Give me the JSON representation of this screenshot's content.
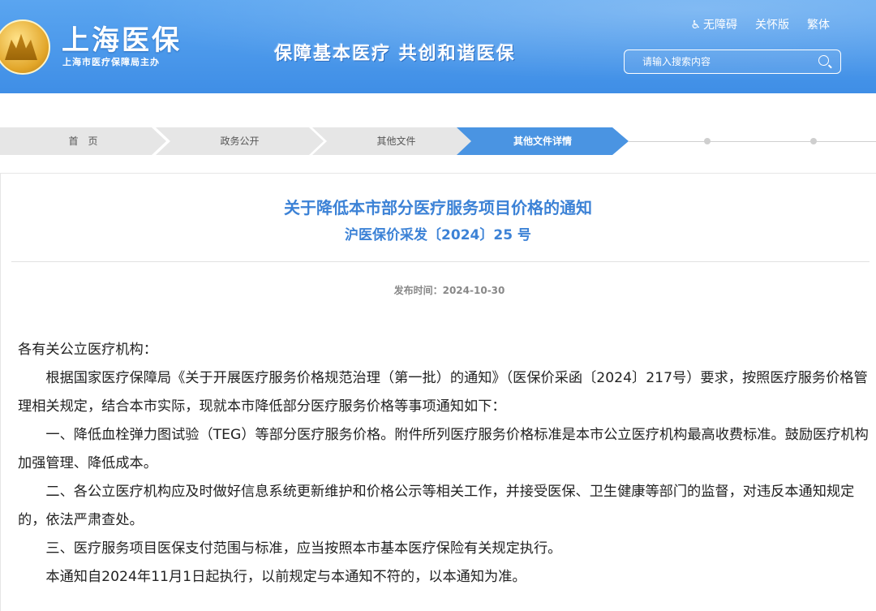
{
  "header": {
    "site_name": "上海医保",
    "site_sub": "上海市医疗保障局主办",
    "slogan": "保障基本医疗  共创和谐医保",
    "top_links": [
      "无障碍",
      "关怀版",
      "繁体"
    ],
    "search_placeholder": "请输入搜索内容"
  },
  "breadcrumb": [
    "首　页",
    "政务公开",
    "其他文件",
    "其他文件详情"
  ],
  "article": {
    "title": "关于降低本市部分医疗服务项目价格的通知",
    "doc_number": "沪医保价采发〔2024〕25 号",
    "publish_label": "发布时间：2024-10-30",
    "paragraphs": [
      "各有关公立医疗机构：",
      "根据国家医疗保障局《关于开展医疗服务价格规范治理（第一批）的通知》（医保价采函〔2024〕217号）要求，按照医疗服务价格管理相关规定，结合本市实际，现就本市降低部分医疗服务价格等事项通知如下：",
      "一、降低血栓弹力图试验（TEG）等部分医疗服务价格。附件所列医疗服务价格标准是本市公立医疗机构最高收费标准。鼓励医疗机构加强管理、降低成本。",
      "二、各公立医疗机构应及时做好信息系统更新维护和价格公示等相关工作，并接受医保、卫生健康等部门的监督，对违反本通知规定的，依法严肃查处。",
      "三、医疗服务项目医保支付范围与标准，应当按照本市基本医疗保险有关规定执行。",
      "本通知自2024年11月1日起执行，以前规定与本通知不符的，以本通知为准。"
    ]
  },
  "colors": {
    "header_blue": "#4a94e2",
    "title_blue": "#3c82d6"
  }
}
